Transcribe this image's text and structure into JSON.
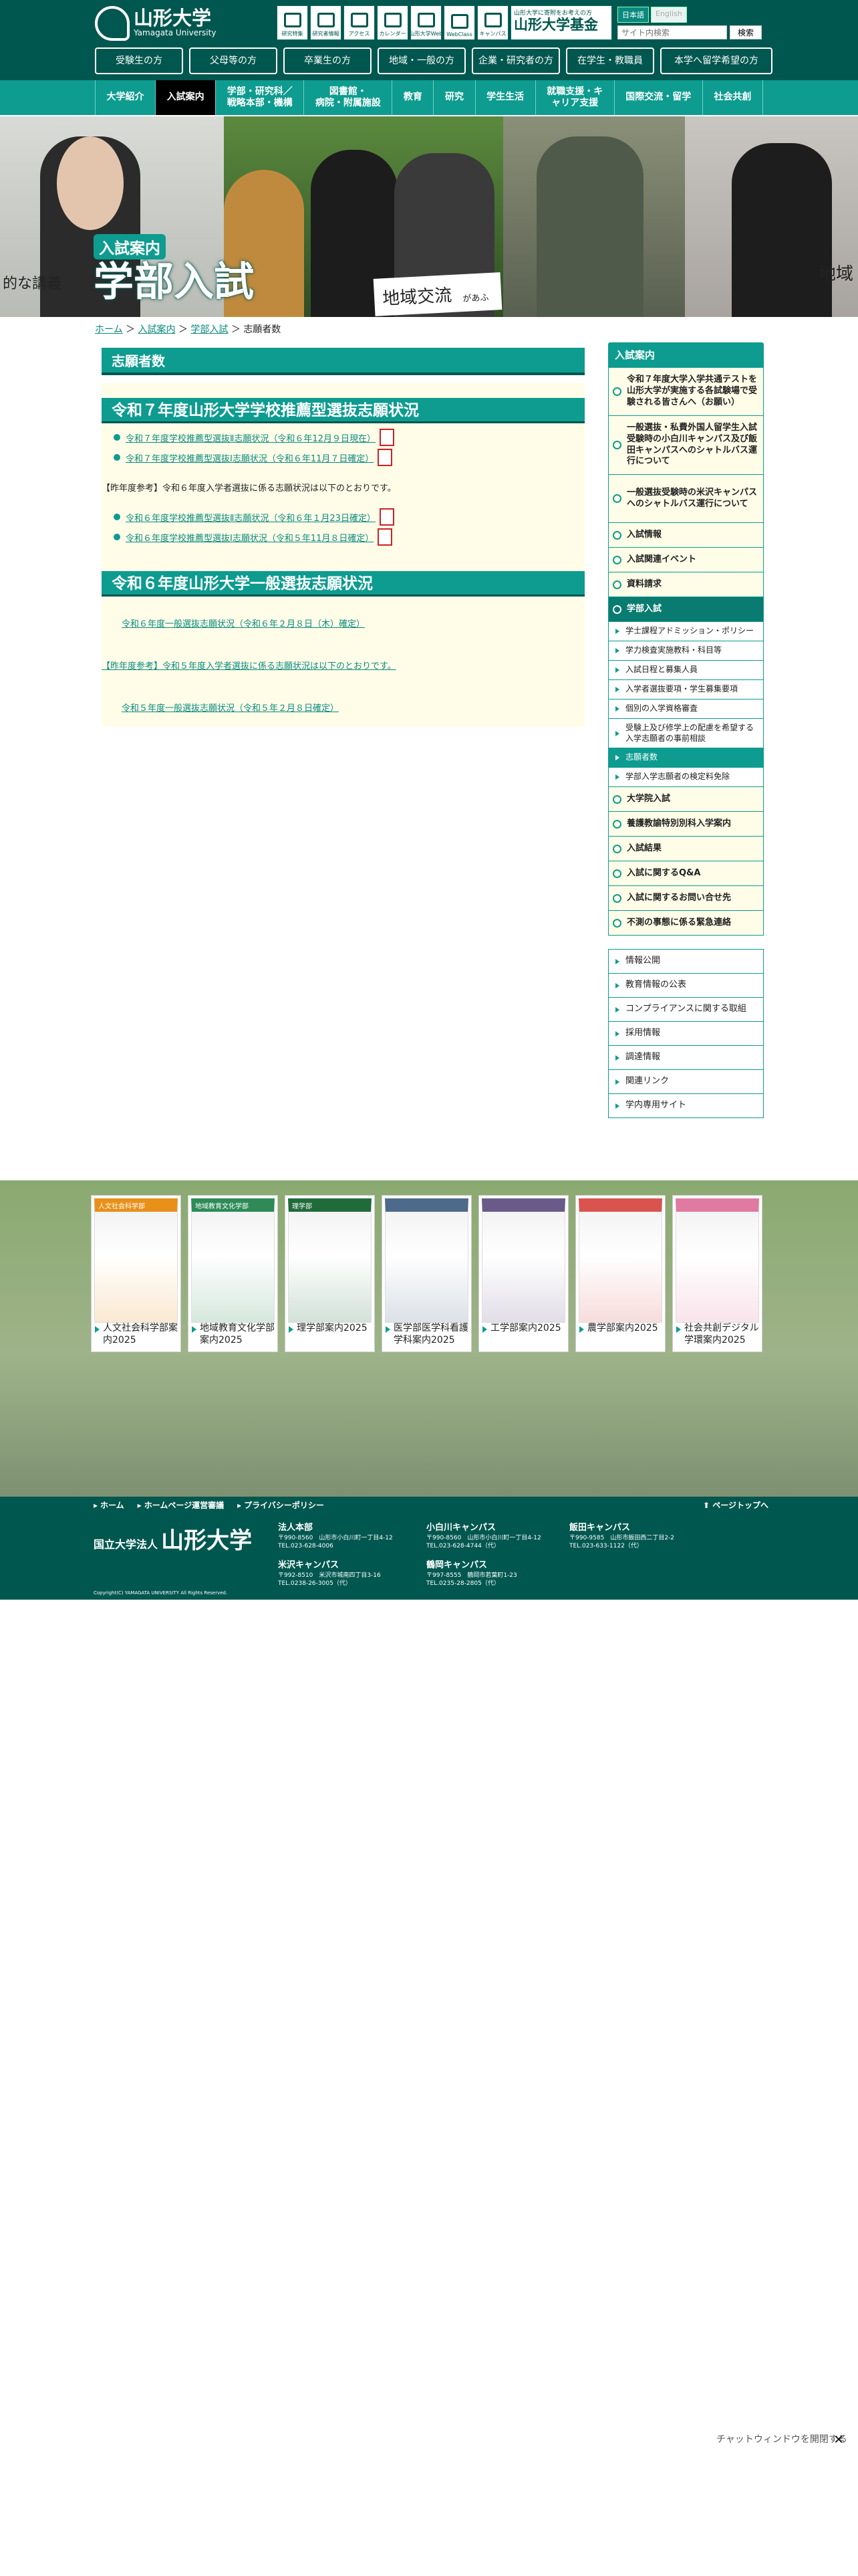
{
  "header": {
    "logo_title": "山形大学",
    "logo_sub": "Yamagata University",
    "tools": [
      {
        "label": "研究特集",
        "icon": "bookmark-icon"
      },
      {
        "label": "研究者情報",
        "icon": "book-icon"
      },
      {
        "label": "アクセス",
        "icon": "map-pin-icon"
      },
      {
        "label": "カレンダー",
        "icon": "calendar-icon"
      },
      {
        "label": "山形大学Web",
        "icon": "screen-icon"
      },
      {
        "label": "WebClass",
        "icon": "laptop-icon"
      },
      {
        "label": "キャンパス",
        "icon": "network-icon"
      }
    ],
    "fund_sub": "山形大学に寄附をお考えの方",
    "fund_title": "山形大学基金",
    "lang_ja": "日本語",
    "lang_en": "English",
    "search_placeholder": "サイト内検索",
    "search_button": "検索",
    "audience": [
      "受験生の方",
      "父母等の方",
      "卒業生の方",
      "地域・一般の方",
      "企業・研究者の方",
      "在学生・教職員",
      "本学へ留学希望の方"
    ]
  },
  "gnav": [
    "大学紹介",
    "入試案内",
    "学部・研究科／\n戦略本部・機構",
    "図書館・\n病院・附属施設",
    "教育",
    "研究",
    "学生生活",
    "就職支援・キ\nャリア支援",
    "国際交流・留学",
    "社会共創"
  ],
  "hero": {
    "sub": "入試案内",
    "title": "学部入試",
    "left_text": "的な講義",
    "sign_text": "地域交流",
    "sign_sub": "があふ",
    "right_text": "地域"
  },
  "breadcrumb": {
    "home": "ホーム",
    "l1": "入試案内",
    "l2": "学部入試",
    "current": "志願者数"
  },
  "main": {
    "page_title": "志願者数",
    "section1": {
      "title": "令和７年度山形大学学校推薦型選抜志願状況",
      "links": [
        "令和７年度学校推薦型選抜Ⅱ志願状況（令和６年12月９日現在）",
        "令和７年度学校推薦型選抜Ⅰ志願状況（令和６年11月７日確定）"
      ],
      "note": "【昨年度参考】令和６年度入学者選抜に係る志願状況は以下のとおりです。",
      "ref_links": [
        "令和６年度学校推薦型選抜Ⅱ志願状況（令和６年１月23日確定）",
        "令和６年度学校推薦型選抜Ⅰ志願状況（令和５年11月８日確定）"
      ]
    },
    "section2": {
      "title": "令和６年度山形大学一般選抜志願状況",
      "link": "令和６年度一般選抜志願状況（令和６年２月８日（木）確定）",
      "note": "【昨年度参考】令和５年度入学者選抜に係る志願状況は以下のとおりです。",
      "ref_link": "令和５年度一般選抜志願状況（令和５年２月８日確定）"
    }
  },
  "sidebar": {
    "heading": "入試案内",
    "top_items": [
      "令和７年度大学入学共通テストを山形大学が実施する各試験場で受験される皆さんへ（お願い）",
      "一般選抜・私費外国人留学生入試受験時の小白川キャンパス及び飯田キャンパスへのシャトルバス運行について",
      "一般選抜受験時の米沢キャンパスへのシャトルバス運行について",
      "入試情報",
      "入試関連イベント",
      "資料請求",
      "学部入試"
    ],
    "sub_items": [
      "学士課程アドミッション・ポリシー",
      "学力検査実施教科・科目等",
      "入試日程と募集人員",
      "入学者選抜要項・学生募集要項",
      "個別の入学資格審査",
      "受験上及び修学上の配慮を希望する入学志願者の事前相談",
      "志願者数",
      "学部入学志願者の検定料免除"
    ],
    "bottom_items": [
      "大学院入試",
      "養護教諭特別別科入学案内",
      "入試結果",
      "入試に関するQ&A",
      "入試に関するお問い合せ先",
      "不測の事態に係る緊急連絡"
    ],
    "extra": [
      "情報公開",
      "教育情報の公表",
      "コンプライアンスに関する取組",
      "採用情報",
      "調達情報",
      "関連リンク",
      "学内専用サイト"
    ]
  },
  "pamphlets": [
    {
      "label": "人文社会科学部案内2025",
      "tag": "人文社会科学部",
      "color": "#e8901a"
    },
    {
      "label": "地域教育文化学部案内2025",
      "tag": "地域教育文化学部",
      "color": "#2e8b57"
    },
    {
      "label": "理学部案内2025",
      "tag": "理学部",
      "color": "#1f6b3a"
    },
    {
      "label": "医学部医学科看護学科案内2025",
      "tag": "",
      "color": "#4d6a8a"
    },
    {
      "label": "工学部案内2025",
      "tag": "",
      "color": "#6a5a8a"
    },
    {
      "label": "農学部案内2025",
      "tag": "",
      "color": "#d9534f"
    },
    {
      "label": "社会共創デジタル学環案内2025",
      "tag": "",
      "color": "#e07aa0"
    }
  ],
  "footer": {
    "links": [
      "ホーム",
      "ホームページ運営審議",
      "プライバシーポリシー"
    ],
    "pagetop": "ページトップへ",
    "org_sub": "国立大学法人",
    "org_name": "山形大学",
    "campuses": [
      {
        "name": "法人本部",
        "addr": "〒990-8560　山形市小白川町一丁目4-12",
        "tel": "TEL.023-628-4006"
      },
      {
        "name": "小白川キャンパス",
        "addr": "〒990-8560　山形市小白川町一丁目4-12",
        "tel": "TEL.023-628-4744（代）"
      },
      {
        "name": "飯田キャンパス",
        "addr": "〒990-9585　山形市飯田西二丁目2-2",
        "tel": "TEL.023-633-1122（代）"
      },
      {
        "name": "米沢キャンパス",
        "addr": "〒992-8510　米沢市城南四丁目3-16",
        "tel": "TEL.0238-26-3005（代）"
      },
      {
        "name": "鶴岡キャンパス",
        "addr": "〒997-8555　鶴岡市若葉町1-23",
        "tel": "TEL.0235-28-2805（代）"
      }
    ],
    "copyright": "Copyright(C) YAMAGATA UNIVERSITY All Rights Reserved."
  },
  "chat": {
    "alt": "チャットウィンドウを開閉する",
    "close": "✕"
  }
}
